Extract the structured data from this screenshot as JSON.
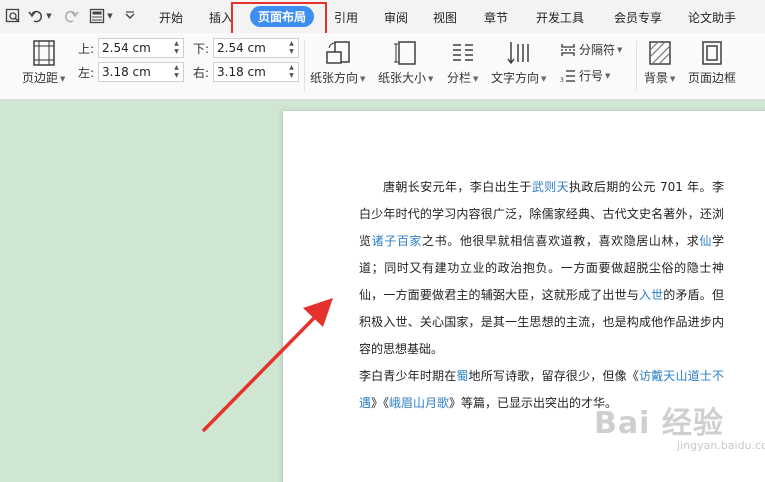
{
  "menu": {
    "tabs": [
      "开始",
      "插入",
      "页面布局",
      "引用",
      "审阅",
      "视图",
      "章节",
      "开发工具",
      "会员专享",
      "论文助手"
    ],
    "active_tab": "页面布局"
  },
  "ribbon": {
    "margins_button": "页边距",
    "margin_top_label": "上:",
    "margin_top_value": "2.54 cm",
    "margin_bottom_label": "下:",
    "margin_bottom_value": "2.54 cm",
    "margin_left_label": "左:",
    "margin_left_value": "3.18 cm",
    "margin_right_label": "右:",
    "margin_right_value": "3.18 cm",
    "orientation_button": "纸张方向",
    "size_button": "纸张大小",
    "columns_button": "分栏",
    "text_direction_button": "文字方向",
    "separator_button": "分隔符",
    "line_number_button": "行号",
    "background_button": "背景",
    "page_border_button": "页面边框"
  },
  "document": {
    "p1_a": "唐朝长安元年，李白出生于",
    "p1_link1": "武则天",
    "p1_b": "执政后期的公元 701 年。李白少年时代的学习内容很广泛，除儒家经典、古代文史名著外，还浏览",
    "p1_link2": "诸子百家",
    "p1_c": "之书。他很早就相信喜欢道教，喜欢隐居山林，求",
    "p1_link3": "仙",
    "p1_d": "学道；同时又有建功立业的政治抱负。一方面要做超脱尘俗的隐士神仙，一方面要做君主的辅弼大臣，这就形成了出世与",
    "p1_link4": "入世",
    "p1_e": "的矛盾。但积极入世、关心国家，是其一生思想的主流，也是构成他作品进步内容的思想基础。",
    "p2_a": "李白青少年时期在",
    "p2_link1": "蜀",
    "p2_b": "地所写诗歌，留存很少，但像《",
    "p2_link2": "访戴天山道士不遇",
    "p2_c": "》《",
    "p2_link3": "峨眉山月歌",
    "p2_d": "》等篇，已显示出突出的才华。"
  },
  "watermark": {
    "main": "Bai 经验",
    "sub": "jingyan.baidu.com"
  },
  "colors": {
    "active_tab": "#3d8ef0",
    "highlight_box": "#e5322d",
    "arrow": "#e5322d",
    "link": "#2e7fc6",
    "canvas": "#cfe6d2"
  }
}
